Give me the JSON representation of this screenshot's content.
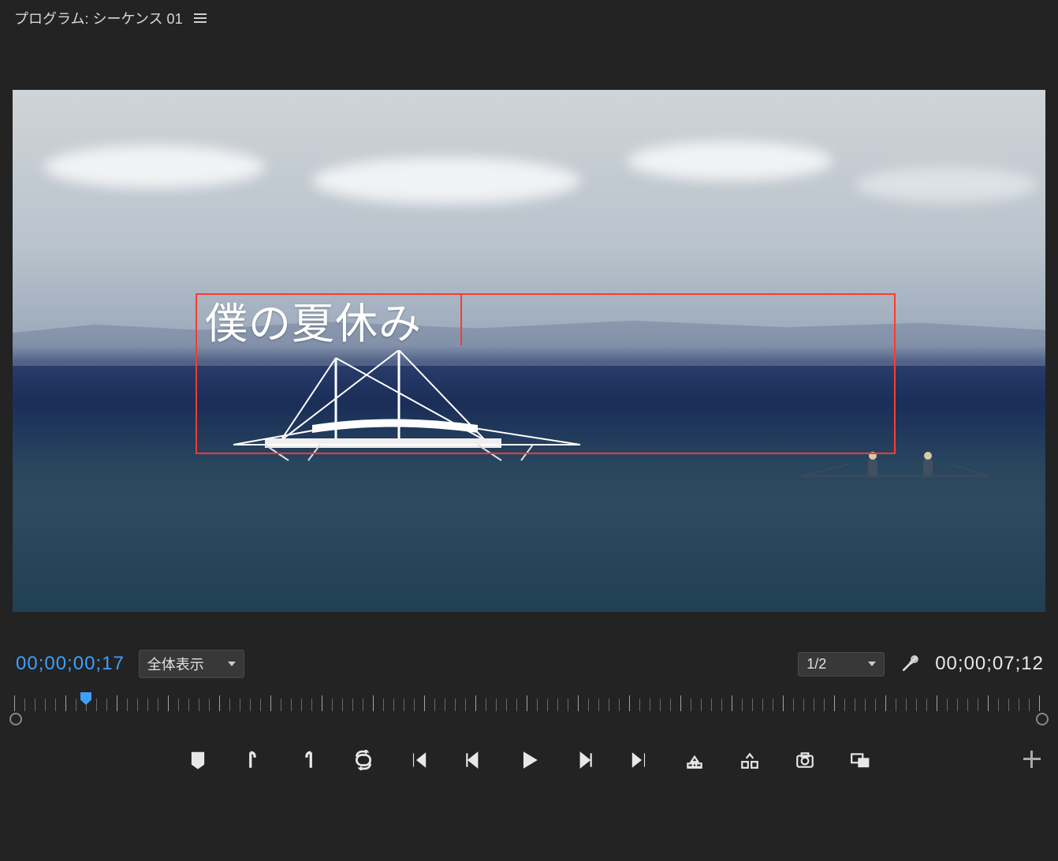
{
  "header": {
    "panel_label": "プログラム: シーケンス 01"
  },
  "overlay": {
    "title_text": "僕の夏休み"
  },
  "track": {
    "current_tc": "00;00;00;17",
    "zoom_label": "全体表示",
    "res_label": "1/2",
    "duration_tc": "00;00;07;12"
  },
  "icons": {
    "mark": "mark-in-out",
    "in": "set-in",
    "out": "set-out",
    "loop": "loop-playback",
    "goto_in": "go-to-in",
    "step_back": "step-back",
    "play": "play",
    "step_fwd": "step-forward",
    "goto_out": "go-to-out",
    "lift": "lift",
    "extract": "extract",
    "snapshot": "export-frame",
    "insert_overlay": "insert-overlay"
  }
}
